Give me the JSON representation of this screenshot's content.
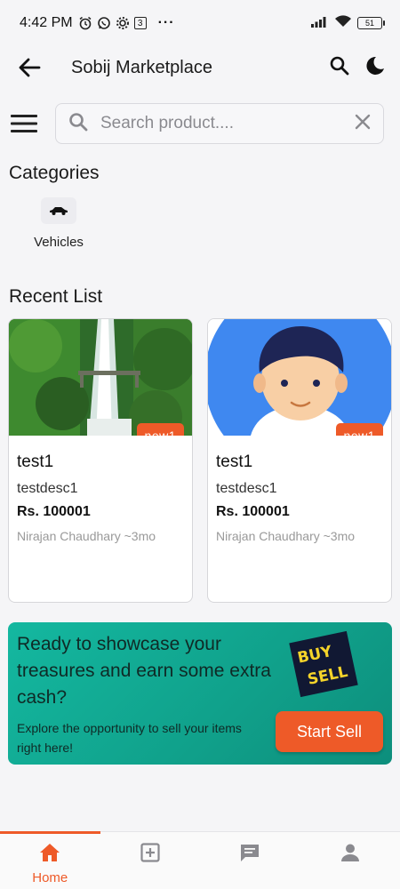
{
  "status_bar": {
    "time": "4:42 PM",
    "notif_count": "3",
    "more": "···",
    "battery": "51"
  },
  "app_bar": {
    "title": "Sobij Marketplace",
    "back_icon": "arrow-left-icon",
    "search_icon": "search-icon",
    "theme_icon": "moon-icon"
  },
  "search": {
    "placeholder": "Search product....",
    "value": ""
  },
  "categories_section": {
    "title": "Categories",
    "items": [
      {
        "label": "Vehicles",
        "icon": "car-icon"
      }
    ]
  },
  "recent_section": {
    "title": "Recent List",
    "items": [
      {
        "badge": "new1",
        "name": "test1",
        "description": "testdesc1",
        "price": "Rs. 100001",
        "meta": "Nirajan Chaudhary ~3mo",
        "image": "waterfall-photo"
      },
      {
        "badge": "new1",
        "name": "test1",
        "description": "testdesc1",
        "price": "Rs. 100001",
        "meta": "Nirajan Chaudhary ~3mo",
        "image": "avatar-illustration"
      }
    ]
  },
  "promo": {
    "headline": "Ready to showcase your treasures and earn some extra cash?",
    "subtext": "Explore the opportunity to sell your items right here!",
    "button_label": "Start Sell",
    "logo_text": "BUY SELL"
  },
  "bottom_nav": {
    "items": [
      {
        "label": "Home",
        "icon": "home-icon",
        "active": true
      },
      {
        "label": "",
        "icon": "add-box-icon",
        "active": false
      },
      {
        "label": "",
        "icon": "chat-icon",
        "active": false
      },
      {
        "label": "",
        "icon": "person-icon",
        "active": false
      }
    ]
  },
  "colors": {
    "accent": "#ee5a28",
    "promo_bg": "#10a08a",
    "background": "#f5f5f7"
  }
}
